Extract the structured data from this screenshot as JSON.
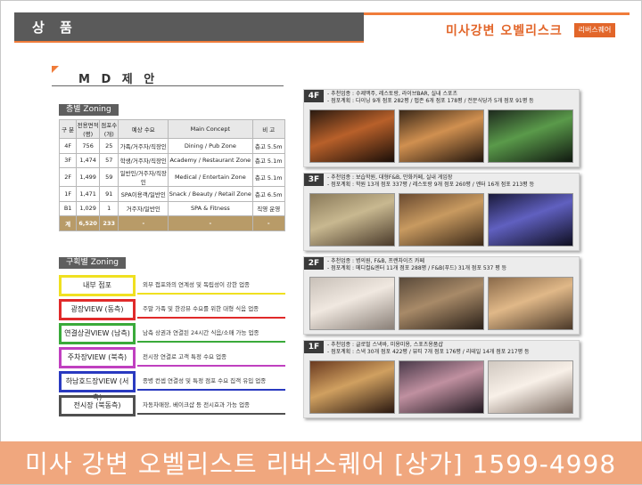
{
  "header": {
    "section_title": "상 품",
    "brand_name": "미사강변 오벨리스크",
    "brand_tag": "리버스퀘어"
  },
  "md": {
    "title": "M D 제 안"
  },
  "floor_zoning": {
    "label": "층별 Zoning",
    "columns": [
      "구 분",
      "전용면적 (평)",
      "점포수 (개)",
      "예상 수요",
      "Main Concept",
      "비 고"
    ],
    "rows": [
      [
        "4F",
        "756",
        "25",
        "가족/거주자/직장인",
        "Dining / Pub Zone",
        "층고 5.5m"
      ],
      [
        "3F",
        "1,474",
        "57",
        "학생/거주자/직장인",
        "Academy / Restaurant Zone",
        "층고 5.1m"
      ],
      [
        "2F",
        "1,499",
        "59",
        "일반인/거주자/직장인",
        "Medical / Entertain Zone",
        "층고 5.1m"
      ],
      [
        "1F",
        "1,471",
        "91",
        "SPA이용객/일반인",
        "Snack / Beauty / Retail Zone",
        "층고 6.5m"
      ],
      [
        "B1",
        "1,029",
        "1",
        "거주자/일반인",
        "SPA & Fitness",
        "직영 운영"
      ]
    ],
    "total": [
      "계",
      "6,520",
      "233",
      "-",
      "-",
      "-"
    ]
  },
  "area_zoning": {
    "label": "구획별 Zoning",
    "items": [
      {
        "name": "내부 점포",
        "desc": "외부 접포와의 연계성 및 독립성이 강한 업종",
        "color": "#f0e020"
      },
      {
        "name": "광장VIEW (동측)",
        "desc": "주말 가족 및 한강뷰 수요를 위한 대형 식음 업종",
        "color": "#e02a2a"
      },
      {
        "name": "연결상권VIEW (남측)",
        "desc": "남측 상권과 연결된 24시간 식음/소매 가능 업종",
        "color": "#3aaa3a"
      },
      {
        "name": "주차장VIEW (북측)",
        "desc": "전시장 연결로 고객 특정 수요 업종",
        "color": "#c040c0"
      },
      {
        "name": "하남호드장VIEW (서측)",
        "desc": "종병 컨셉 연결성 및 특정 점포 수요 집객 유입 업종",
        "color": "#2a3ac0"
      },
      {
        "name": "전시장 (북동측)",
        "desc": "자동차매장, 베이크샵 등 전시효과 가능 업종",
        "color": "#505050"
      }
    ]
  },
  "floors": [
    {
      "tag": "4F",
      "line1": "- 추천업종 : 수제맥주, 레스토랑, 라이브BAR, 실내 스포츠",
      "line2": "- 점포계획 : 다이닝 9개 점포 282평 / 펍존 6개 점포 178평 / 전문식당가 5개 점포 91평 등"
    },
    {
      "tag": "3F",
      "line1": "- 추천업종 : 보습학원, 대형F&B, 만화카페, 실내 게임장",
      "line2": "- 점포계획 : 학원 13개 점포 337평 / 레스토랑 9개 점포 260평 / 엔터 16개 점포 213평 등"
    },
    {
      "tag": "2F",
      "line1": "- 추천업종 : 병의원, F&B, 프랜차이즈 카페",
      "line2": "- 점포계획 : 메디컬&엔터 11개 점포 288평 / F&B(푸드) 31개 점포 537 평 등"
    },
    {
      "tag": "1F",
      "line1": "- 추천업종 : 글로벌 스낵바, 미용미용, 스포츠용품샵",
      "line2": "- 점포계획 : 스낵 30개 점포 422평 / 뷰티 7개 점포 176평 / 리테일 14개 점포 217평 등"
    }
  ],
  "banner": {
    "text": "미사 강변 오벨리스트 리버스퀘어 [상가]   1599-4998"
  },
  "colors": {
    "accent": "#f07c3a",
    "banner": "#f0a77e",
    "header_gray": "#5a5a5a",
    "total_row": "#b89b68"
  }
}
